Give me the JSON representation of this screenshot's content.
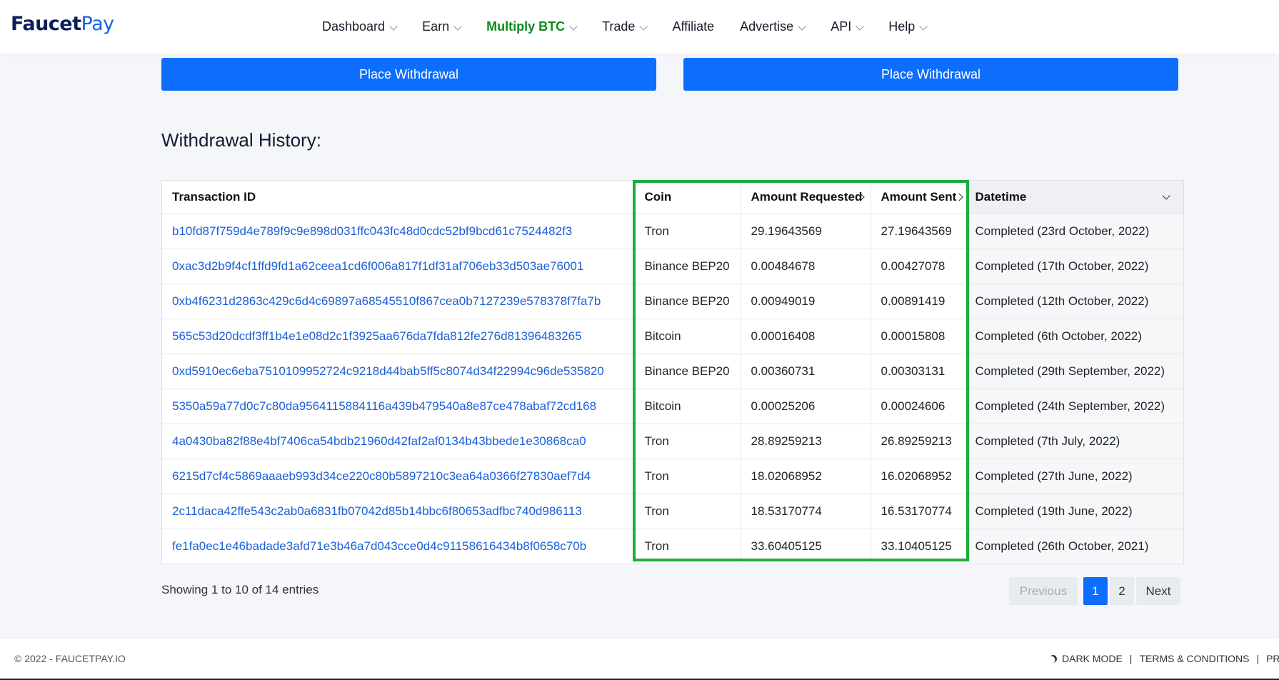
{
  "brand": {
    "part1": "Faucet",
    "part2": "Pay"
  },
  "nav": [
    {
      "label": "Dashboard",
      "dropdown": true,
      "active": false
    },
    {
      "label": "Earn",
      "dropdown": true,
      "active": false
    },
    {
      "label": "Multiply BTC",
      "dropdown": true,
      "active": true
    },
    {
      "label": "Trade",
      "dropdown": true,
      "active": false
    },
    {
      "label": "Affiliate",
      "dropdown": false,
      "active": false
    },
    {
      "label": "Advertise",
      "dropdown": true,
      "active": false
    },
    {
      "label": "API",
      "dropdown": true,
      "active": false
    },
    {
      "label": "Help",
      "dropdown": true,
      "active": false
    }
  ],
  "buttons": {
    "withdraw_left": "Place Withdrawal",
    "withdraw_right": "Place Withdrawal"
  },
  "history": {
    "title": "Withdrawal History:",
    "columns": {
      "txid": "Transaction ID",
      "coin": "Coin",
      "requested": "Amount Requested",
      "sent": "Amount Sent",
      "datetime": "Datetime"
    },
    "rows": [
      {
        "txid": "b10fd87f759d4e789f9c9e898d031ffc043fc48d0cdc52bf9bcd61c7524482f3",
        "coin": "Tron",
        "requested": "29.19643569",
        "sent": "27.19643569",
        "datetime": "Completed (23rd October, 2022)"
      },
      {
        "txid": "0xac3d2b9f4cf1ffd9fd1a62ceea1cd6f006a817f1df31af706eb33d503ae76001",
        "coin": "Binance BEP20",
        "requested": "0.00484678",
        "sent": "0.00427078",
        "datetime": "Completed (17th October, 2022)"
      },
      {
        "txid": "0xb4f6231d2863c429c6d4c69897a68545510f867cea0b7127239e578378f7fa7b",
        "coin": "Binance BEP20",
        "requested": "0.00949019",
        "sent": "0.00891419",
        "datetime": "Completed (12th October, 2022)"
      },
      {
        "txid": "565c53d20dcdf3ff1b4e1e08d2c1f3925aa676da7fda812fe276d81396483265",
        "coin": "Bitcoin",
        "requested": "0.00016408",
        "sent": "0.00015808",
        "datetime": "Completed (6th October, 2022)"
      },
      {
        "txid": "0xd5910ec6eba7510109952724c9218d44bab5ff5c8074d34f22994c96de535820",
        "coin": "Binance BEP20",
        "requested": "0.00360731",
        "sent": "0.00303131",
        "datetime": "Completed (29th September, 2022)"
      },
      {
        "txid": "5350a59a77d0c7c80da9564115884116a439b479540a8e87ce478abaf72cd168",
        "coin": "Bitcoin",
        "requested": "0.00025206",
        "sent": "0.00024606",
        "datetime": "Completed (24th September, 2022)"
      },
      {
        "txid": "4a0430ba82f88e4bf7406ca54bdb21960d42faf2af0134b43bbede1e30868ca0",
        "coin": "Tron",
        "requested": "28.89259213",
        "sent": "26.89259213",
        "datetime": "Completed (7th July, 2022)"
      },
      {
        "txid": "6215d7cf4c5869aaaeb993d34ce220c80b5897210c3ea64a0366f27830aef7d4",
        "coin": "Tron",
        "requested": "18.02068952",
        "sent": "16.02068952",
        "datetime": "Completed (27th June, 2022)"
      },
      {
        "txid": "2c11daca42ffe543c2ab0a6831fb07042d85b14bbc6f80653adfbc740d986113",
        "coin": "Tron",
        "requested": "18.53170774",
        "sent": "16.53170774",
        "datetime": "Completed (19th June, 2022)"
      },
      {
        "txid": "fe1fa0ec1e46badade3afd71e3b46a7d043cce0d4c91158616434b8f0658c70b",
        "coin": "Tron",
        "requested": "33.60405125",
        "sent": "33.10405125",
        "datetime": "Completed (26th October, 2021)"
      }
    ]
  },
  "pagination": {
    "info": "Showing 1 to 10 of 14 entries",
    "previous": "Previous",
    "pages": [
      "1",
      "2"
    ],
    "current": "1",
    "next": "Next"
  },
  "footer": {
    "copyright": "© 2022 - FAUCETPAY.IO",
    "dark_mode": "DARK MODE",
    "terms": "TERMS & CONDITIONS",
    "privacy": "PRIVAC"
  },
  "colors": {
    "primary": "#0d6efd",
    "active_nav": "#0d8a1a",
    "highlight": "#1fab3c",
    "link": "#1b5fd8"
  }
}
